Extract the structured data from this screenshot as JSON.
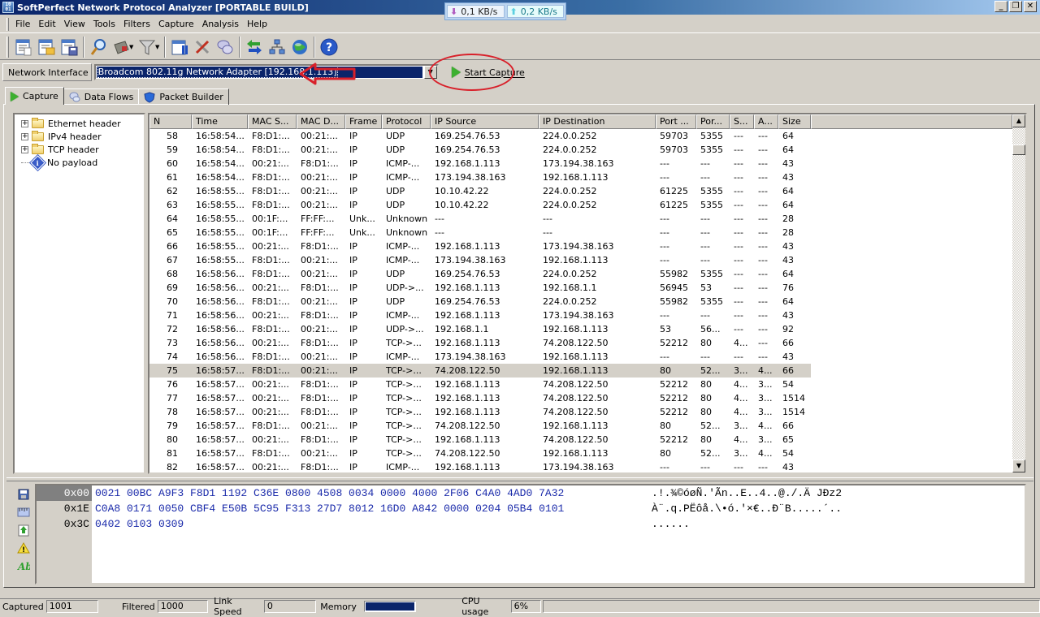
{
  "window": {
    "title": "SoftPerfect Network Protocol Analyzer [PORTABLE BUILD]",
    "download_speed": "0,1 KB/s",
    "upload_speed": "0,2 KB/s",
    "minimize": "_",
    "restore": "❐",
    "close": "✕"
  },
  "menu": [
    "File",
    "Edit",
    "View",
    "Tools",
    "Filters",
    "Capture",
    "Analysis",
    "Help"
  ],
  "toolbar": {
    "buttons": [
      "new-capture-icon",
      "open-capture-icon",
      "save-capture-icon",
      "find-icon",
      "bookmark-icon",
      "filter-icon",
      "columns-icon",
      "tools-icon",
      "chat-icon",
      "data-flows-icon",
      "network-icon",
      "globe-icon",
      "help-icon"
    ]
  },
  "interface": {
    "label": "Network Interface",
    "selected": "Broadcom 802.11g Network Adapter [192.168.1.113]",
    "start_button": "Start Capture"
  },
  "tabs": [
    {
      "label": "Capture",
      "icon": "play-icon",
      "active": true
    },
    {
      "label": "Data Flows",
      "icon": "data-flows-icon",
      "active": false
    },
    {
      "label": "Packet Builder",
      "icon": "shield-icon",
      "active": false
    }
  ],
  "tree": [
    {
      "label": "Ethernet header",
      "type": "folder"
    },
    {
      "label": "IPv4 header",
      "type": "folder"
    },
    {
      "label": "TCP header",
      "type": "folder"
    },
    {
      "label": "No payload",
      "type": "info"
    }
  ],
  "table": {
    "columns": [
      "N",
      "Time",
      "MAC S...",
      "MAC D...",
      "Frame",
      "Protocol",
      "IP Source",
      "IP Destination",
      "Port ...",
      "Por...",
      "S...",
      "A...",
      "Size"
    ],
    "selected_row": 75,
    "rows": [
      [
        "58",
        "16:58:54...",
        "F8:D1:...",
        "00:21:...",
        "IP",
        "UDP",
        "169.254.76.53",
        "224.0.0.252",
        "59703",
        "5355",
        "---",
        "---",
        "64"
      ],
      [
        "59",
        "16:58:54...",
        "F8:D1:...",
        "00:21:...",
        "IP",
        "UDP",
        "169.254.76.53",
        "224.0.0.252",
        "59703",
        "5355",
        "---",
        "---",
        "64"
      ],
      [
        "60",
        "16:58:54...",
        "00:21:...",
        "F8:D1:...",
        "IP",
        "ICMP-...",
        "192.168.1.113",
        "173.194.38.163",
        "---",
        "---",
        "---",
        "---",
        "43"
      ],
      [
        "61",
        "16:58:54...",
        "F8:D1:...",
        "00:21:...",
        "IP",
        "ICMP-...",
        "173.194.38.163",
        "192.168.1.113",
        "---",
        "---",
        "---",
        "---",
        "43"
      ],
      [
        "62",
        "16:58:55...",
        "F8:D1:...",
        "00:21:...",
        "IP",
        "UDP",
        "10.10.42.22",
        "224.0.0.252",
        "61225",
        "5355",
        "---",
        "---",
        "64"
      ],
      [
        "63",
        "16:58:55...",
        "F8:D1:...",
        "00:21:...",
        "IP",
        "UDP",
        "10.10.42.22",
        "224.0.0.252",
        "61225",
        "5355",
        "---",
        "---",
        "64"
      ],
      [
        "64",
        "16:58:55...",
        "00:1F:...",
        "FF:FF:...",
        "Unk...",
        "Unknown",
        "---",
        "---",
        "---",
        "---",
        "---",
        "---",
        "28"
      ],
      [
        "65",
        "16:58:55...",
        "00:1F:...",
        "FF:FF:...",
        "Unk...",
        "Unknown",
        "---",
        "---",
        "---",
        "---",
        "---",
        "---",
        "28"
      ],
      [
        "66",
        "16:58:55...",
        "00:21:...",
        "F8:D1:...",
        "IP",
        "ICMP-...",
        "192.168.1.113",
        "173.194.38.163",
        "---",
        "---",
        "---",
        "---",
        "43"
      ],
      [
        "67",
        "16:58:55...",
        "F8:D1:...",
        "00:21:...",
        "IP",
        "ICMP-...",
        "173.194.38.163",
        "192.168.1.113",
        "---",
        "---",
        "---",
        "---",
        "43"
      ],
      [
        "68",
        "16:58:56...",
        "F8:D1:...",
        "00:21:...",
        "IP",
        "UDP",
        "169.254.76.53",
        "224.0.0.252",
        "55982",
        "5355",
        "---",
        "---",
        "64"
      ],
      [
        "69",
        "16:58:56...",
        "00:21:...",
        "F8:D1:...",
        "IP",
        "UDP->...",
        "192.168.1.113",
        "192.168.1.1",
        "56945",
        "53",
        "---",
        "---",
        "76"
      ],
      [
        "70",
        "16:58:56...",
        "F8:D1:...",
        "00:21:...",
        "IP",
        "UDP",
        "169.254.76.53",
        "224.0.0.252",
        "55982",
        "5355",
        "---",
        "---",
        "64"
      ],
      [
        "71",
        "16:58:56...",
        "00:21:...",
        "F8:D1:...",
        "IP",
        "ICMP-...",
        "192.168.1.113",
        "173.194.38.163",
        "---",
        "---",
        "---",
        "---",
        "43"
      ],
      [
        "72",
        "16:58:56...",
        "F8:D1:...",
        "00:21:...",
        "IP",
        "UDP->...",
        "192.168.1.1",
        "192.168.1.113",
        "53",
        "56...",
        "---",
        "---",
        "92"
      ],
      [
        "73",
        "16:58:56...",
        "00:21:...",
        "F8:D1:...",
        "IP",
        "TCP->...",
        "192.168.1.113",
        "74.208.122.50",
        "52212",
        "80",
        "4...",
        "---",
        "66"
      ],
      [
        "74",
        "16:58:56...",
        "F8:D1:...",
        "00:21:...",
        "IP",
        "ICMP-...",
        "173.194.38.163",
        "192.168.1.113",
        "---",
        "---",
        "---",
        "---",
        "43"
      ],
      [
        "75",
        "16:58:57...",
        "F8:D1:...",
        "00:21:...",
        "IP",
        "TCP->...",
        "74.208.122.50",
        "192.168.1.113",
        "80",
        "52...",
        "3...",
        "4...",
        "66"
      ],
      [
        "76",
        "16:58:57...",
        "00:21:...",
        "F8:D1:...",
        "IP",
        "TCP->...",
        "192.168.1.113",
        "74.208.122.50",
        "52212",
        "80",
        "4...",
        "3...",
        "54"
      ],
      [
        "77",
        "16:58:57...",
        "00:21:...",
        "F8:D1:...",
        "IP",
        "TCP->...",
        "192.168.1.113",
        "74.208.122.50",
        "52212",
        "80",
        "4...",
        "3...",
        "1514"
      ],
      [
        "78",
        "16:58:57...",
        "00:21:...",
        "F8:D1:...",
        "IP",
        "TCP->...",
        "192.168.1.113",
        "74.208.122.50",
        "52212",
        "80",
        "4...",
        "3...",
        "1514"
      ],
      [
        "79",
        "16:58:57...",
        "F8:D1:...",
        "00:21:...",
        "IP",
        "TCP->...",
        "74.208.122.50",
        "192.168.1.113",
        "80",
        "52...",
        "3...",
        "4...",
        "66"
      ],
      [
        "80",
        "16:58:57...",
        "00:21:...",
        "F8:D1:...",
        "IP",
        "TCP->...",
        "192.168.1.113",
        "74.208.122.50",
        "52212",
        "80",
        "4...",
        "3...",
        "65"
      ],
      [
        "81",
        "16:58:57...",
        "F8:D1:...",
        "00:21:...",
        "IP",
        "TCP->...",
        "74.208.122.50",
        "192.168.1.113",
        "80",
        "52...",
        "3...",
        "4...",
        "54"
      ],
      [
        "82",
        "16:58:57...",
        "00:21:...",
        "F8:D1:...",
        "IP",
        "ICMP-...",
        "192.168.1.113",
        "173.194.38.163",
        "---",
        "---",
        "---",
        "---",
        "43"
      ]
    ]
  },
  "hex": {
    "offsets": [
      "0x00",
      "0x1E",
      "0x3C"
    ],
    "lines": [
      "0021 00BC A9F3 F8D1 1192 C36E 0800 4508 0034 0000 4000 2F06 C4A0 4AD0 7A32",
      "C0A8 0171 0050 CBF4 E50B 5C95 F313 27D7 8012 16D0 A842 0000 0204 05B4 0101",
      "0402 0103 0309"
    ],
    "ascii": [
      ".!.¾©óøÑ.'Ãn..E..4..@./.Ä JÐz2",
      "À¨.q.PËôå.\\•ó.'×€..Ð¨B.....´..",
      "......"
    ],
    "side_icons": [
      "save-icon",
      "ruler-icon",
      "export-icon",
      "warning-icon",
      "font-icon"
    ]
  },
  "status": {
    "captured_label": "Captured",
    "captured": "1001",
    "filtered_label": "Filtered",
    "filtered": "1000",
    "link_speed_label": "Link Speed",
    "link_speed": "0",
    "memory_label": "Memory",
    "memory_fraction": 1.0,
    "cpu_label": "CPU usage",
    "cpu": "6%"
  }
}
